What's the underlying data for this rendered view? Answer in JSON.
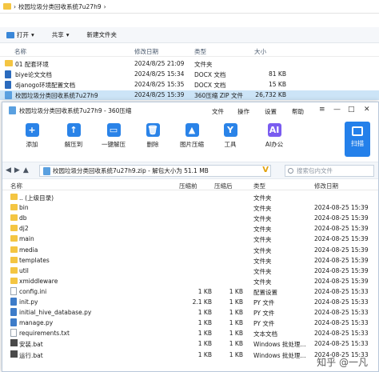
{
  "explorer": {
    "path": "校园垃圾分类回收系统7u27h9",
    "toolbar": {
      "open": "打开",
      "share": "共享",
      "new_folder": "新建文件夹"
    },
    "columns": [
      "名称",
      "修改日期",
      "类型",
      "大小"
    ],
    "rows": [
      {
        "name": "01 配套环境",
        "date": "2024/8/25 21:09",
        "type": "文件夹",
        "size": "",
        "icon": "folder"
      },
      {
        "name": "biye论文文档",
        "date": "2024/8/25 15:34",
        "type": "DOCX 文档",
        "size": "81 KB",
        "icon": "docx"
      },
      {
        "name": "djanogo环境配置文档",
        "date": "2024/8/25 15:35",
        "type": "DOCX 文档",
        "size": "15 KB",
        "icon": "docx"
      },
      {
        "name": "校园垃圾分类回收系统7u27h9",
        "date": "2024/8/25 15:39",
        "type": "360压缩 ZIP 文件",
        "size": "26,732 KB",
        "icon": "zip"
      }
    ]
  },
  "zip": {
    "title": "校园垃圾分类回收系统7u27h9 - 360压缩",
    "menu": [
      "文件",
      "操作",
      "设置",
      "帮助"
    ],
    "window_controls": [
      "≡",
      "—",
      "□",
      "✕"
    ],
    "tools": [
      {
        "label": "添加",
        "icon": "add-icon",
        "glyph": "+",
        "color": "#2a83e8"
      },
      {
        "label": "解压到",
        "icon": "extract-to-icon",
        "glyph": "↑",
        "color": "#2a83e8"
      },
      {
        "label": "一键解压",
        "icon": "one-click-extract-icon",
        "glyph": "▭",
        "color": "#2a83e8"
      },
      {
        "label": "删除",
        "icon": "delete-icon",
        "glyph": "🗑",
        "color": "#2a83e8"
      },
      {
        "label": "图片压缩",
        "icon": "image-compress-icon",
        "glyph": "▲",
        "color": "#2a83e8"
      },
      {
        "label": "工具",
        "icon": "tools-icon",
        "glyph": "Y",
        "color": "#2a83e8"
      },
      {
        "label": "AI办公",
        "icon": "ai-office-icon",
        "glyph": "AI",
        "color": "#7a5cf0"
      }
    ],
    "scan": "扫描",
    "nav": {
      "back": "◀",
      "forward": "▶",
      "up": "▲",
      "path": "校园垃圾分类回收系统7u27h9.zip - 解包大小为 51.1 MB",
      "dropdown": "V",
      "search_placeholder": "搜索包内文件"
    },
    "columns": {
      "name": "名称",
      "compressed": "压缩前",
      "packed": "压缩后",
      "type": "类型",
      "modified": "修改日期"
    },
    "files": [
      {
        "name": ".. (上级目录)",
        "before": "",
        "after": "",
        "type": "文件夹",
        "date": "",
        "icon": "up"
      },
      {
        "name": "bin",
        "before": "",
        "after": "",
        "type": "文件夹",
        "date": "2024-08-25 15:39",
        "icon": "folder"
      },
      {
        "name": "db",
        "before": "",
        "after": "",
        "type": "文件夹",
        "date": "2024-08-25 15:39",
        "icon": "folder"
      },
      {
        "name": "dj2",
        "before": "",
        "after": "",
        "type": "文件夹",
        "date": "2024-08-25 15:39",
        "icon": "folder"
      },
      {
        "name": "main",
        "before": "",
        "after": "",
        "type": "文件夹",
        "date": "2024-08-25 15:39",
        "icon": "folder"
      },
      {
        "name": "media",
        "before": "",
        "after": "",
        "type": "文件夹",
        "date": "2024-08-25 15:39",
        "icon": "folder"
      },
      {
        "name": "templates",
        "before": "",
        "after": "",
        "type": "文件夹",
        "date": "2024-08-25 15:39",
        "icon": "folder"
      },
      {
        "name": "util",
        "before": "",
        "after": "",
        "type": "文件夹",
        "date": "2024-08-25 15:39",
        "icon": "folder"
      },
      {
        "name": "xmiddleware",
        "before": "",
        "after": "",
        "type": "文件夹",
        "date": "2024-08-25 15:39",
        "icon": "folder"
      },
      {
        "name": "config.ini",
        "before": "1 KB",
        "after": "1 KB",
        "type": "配置设置",
        "date": "2024-08-25 15:33",
        "icon": "file"
      },
      {
        "name": "init.py",
        "before": "2.1 KB",
        "after": "1 KB",
        "type": "PY 文件",
        "date": "2024-08-25 15:33",
        "icon": "py"
      },
      {
        "name": "initial_hive_database.py",
        "before": "1 KB",
        "after": "1 KB",
        "type": "PY 文件",
        "date": "2024-08-25 15:33",
        "icon": "py"
      },
      {
        "name": "manage.py",
        "before": "1 KB",
        "after": "1 KB",
        "type": "PY 文件",
        "date": "2024-08-25 15:33",
        "icon": "py"
      },
      {
        "name": "requirements.txt",
        "before": "1 KB",
        "after": "1 KB",
        "type": "文本文档",
        "date": "2024-08-25 15:33",
        "icon": "file"
      },
      {
        "name": "安装.bat",
        "before": "1 KB",
        "after": "1 KB",
        "type": "Windows 批处理...",
        "date": "2024-08-25 15:33",
        "icon": "bat"
      },
      {
        "name": "运行.bat",
        "before": "1 KB",
        "after": "1 KB",
        "type": "Windows 批处理...",
        "date": "2024-08-25 15:33",
        "icon": "bat"
      }
    ]
  },
  "watermark": "知乎 @一凡"
}
